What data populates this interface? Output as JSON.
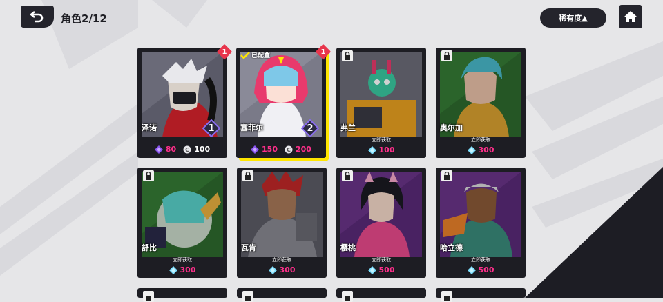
{
  "header": {
    "title": "角色",
    "count": "2/12",
    "sort_label": "稀有度▲"
  },
  "colors": {
    "dark": "#24242c",
    "accent_yellow": "#ffe600",
    "notify_red": "#e8354c",
    "gem_pink": "#ff2f8b"
  },
  "icons": {
    "back": "back-arrow-icon",
    "home": "home-icon",
    "lock": "lock-icon",
    "check": "check-icon",
    "gem": "purple-gem-icon",
    "coin": "coin-icon",
    "crystal": "crystal-icon"
  },
  "characters": [
    {
      "name": "泽诺",
      "level": "1",
      "notify": "1",
      "cost_gem": "80",
      "cost_coin": "100"
    },
    {
      "name": "塞菲尔",
      "level": "2",
      "notify": "1",
      "equipped_label": "已配置",
      "cost_gem": "150",
      "cost_coin": "200"
    },
    {
      "name": "弗兰",
      "unlock_label": "立即获取",
      "unlock_cost": "100"
    },
    {
      "name": "奥尔加",
      "unlock_label": "立即获取",
      "unlock_cost": "300"
    },
    {
      "name": "舒比",
      "unlock_label": "立即获取",
      "unlock_cost": "300"
    },
    {
      "name": "瓦肯",
      "unlock_label": "立即获取",
      "unlock_cost": "300"
    },
    {
      "name": "樱桃",
      "unlock_label": "立即获取",
      "unlock_cost": "500"
    },
    {
      "name": "哈立德",
      "unlock_label": "立即获取",
      "unlock_cost": "500"
    }
  ]
}
